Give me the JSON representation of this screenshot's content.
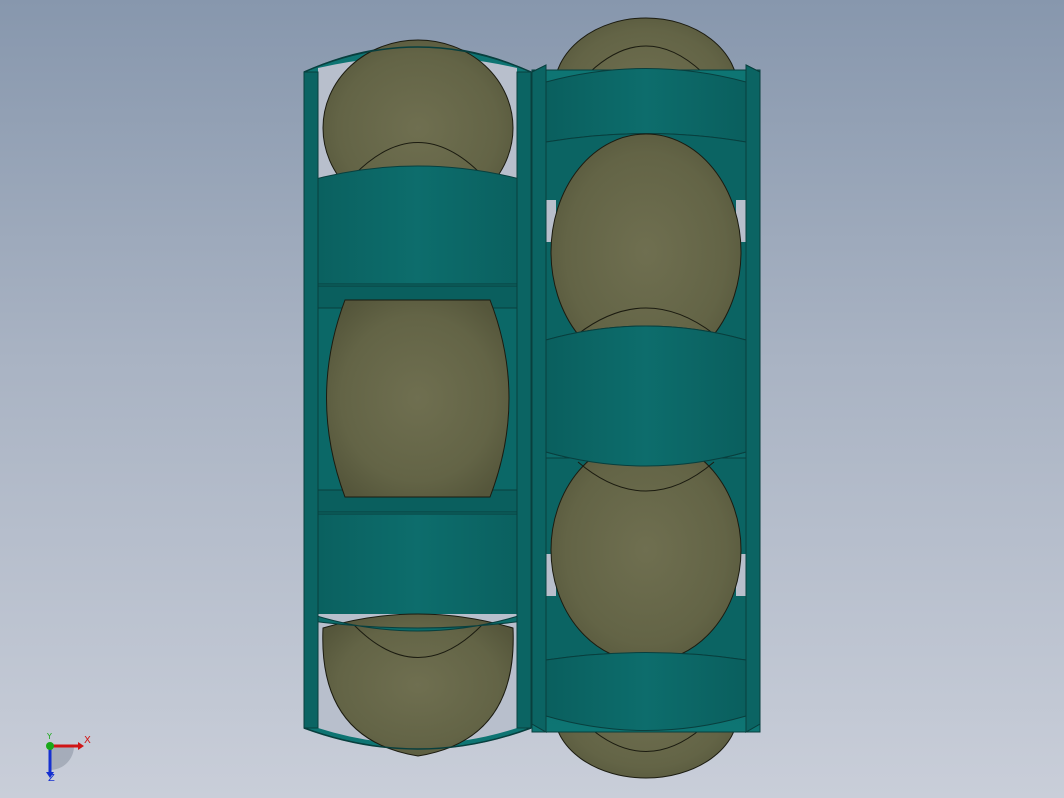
{
  "model_view": {
    "part": "mecanum-wheel-pair",
    "colors": {
      "hub": "#0c6d6b",
      "hub_edge": "#0a4f4e",
      "roller": "#6e6e4e",
      "roller_dark": "#4e4e35",
      "background_top": "#8797ad",
      "background_bottom": "#c9ced9"
    }
  },
  "triad": {
    "x_label": "X",
    "y_label": "Y",
    "z_label": "Z",
    "x_color": "#d01515",
    "y_color": "#18a818",
    "z_color": "#1530d0"
  }
}
